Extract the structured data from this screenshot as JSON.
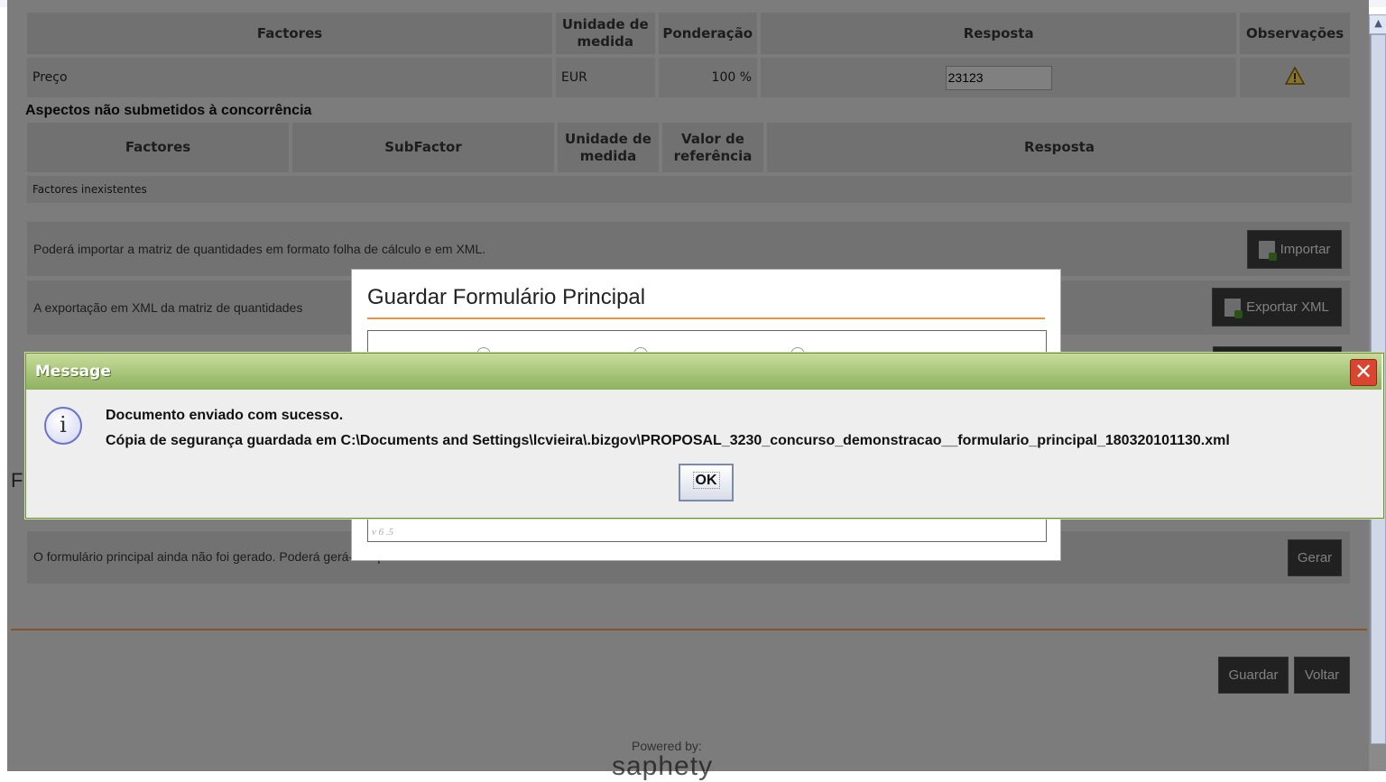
{
  "table1": {
    "headers": [
      "Factores",
      "Unidade de medida",
      "Ponderação",
      "Resposta",
      "Observações"
    ],
    "row": {
      "factor": "Preço",
      "unit": "EUR",
      "weight": "100 %",
      "answer": "23123"
    }
  },
  "section2": {
    "title": "Aspectos não submetidos à concorrência",
    "headers": [
      "Factores",
      "SubFactor",
      "Unidade de medida",
      "Valor de referência",
      "Resposta"
    ],
    "empty_text": "Factores inexistentes"
  },
  "import_band": {
    "text": "Poderá importar a matriz de quantidades em formato folha de cálculo e em XML.",
    "button": "Importar"
  },
  "export_band": {
    "text": "A exportação em XML da matriz de quantidades",
    "button": "Exportar XML"
  },
  "form_section": {
    "heading_letter": "F",
    "text": "O formulário principal ainda não foi gerado. Poderá gerá-lo aqui.",
    "button": "Gerar"
  },
  "footer": {
    "save": "Guardar",
    "back": "Voltar",
    "powered_by": "Powered by:",
    "brand": "saphety"
  },
  "modal": {
    "title": "Guardar Formulário Principal",
    "version": "v 6 .5"
  },
  "dialog": {
    "title": "Message",
    "line1": "Documento enviado com sucesso.",
    "line2": "Cópia de segurança guardada em C:\\Documents and Settings\\lcvieira\\.bizgov\\PROPOSAL_3230_concurso_demonstracao__formulario_principal_180320101130.xml",
    "ok": "OK",
    "icon": "info-icon",
    "close_icon": "close-icon"
  },
  "colors": {
    "accent": "#e8934a",
    "dialog_title": "#8fb160",
    "close": "#d9452e"
  }
}
